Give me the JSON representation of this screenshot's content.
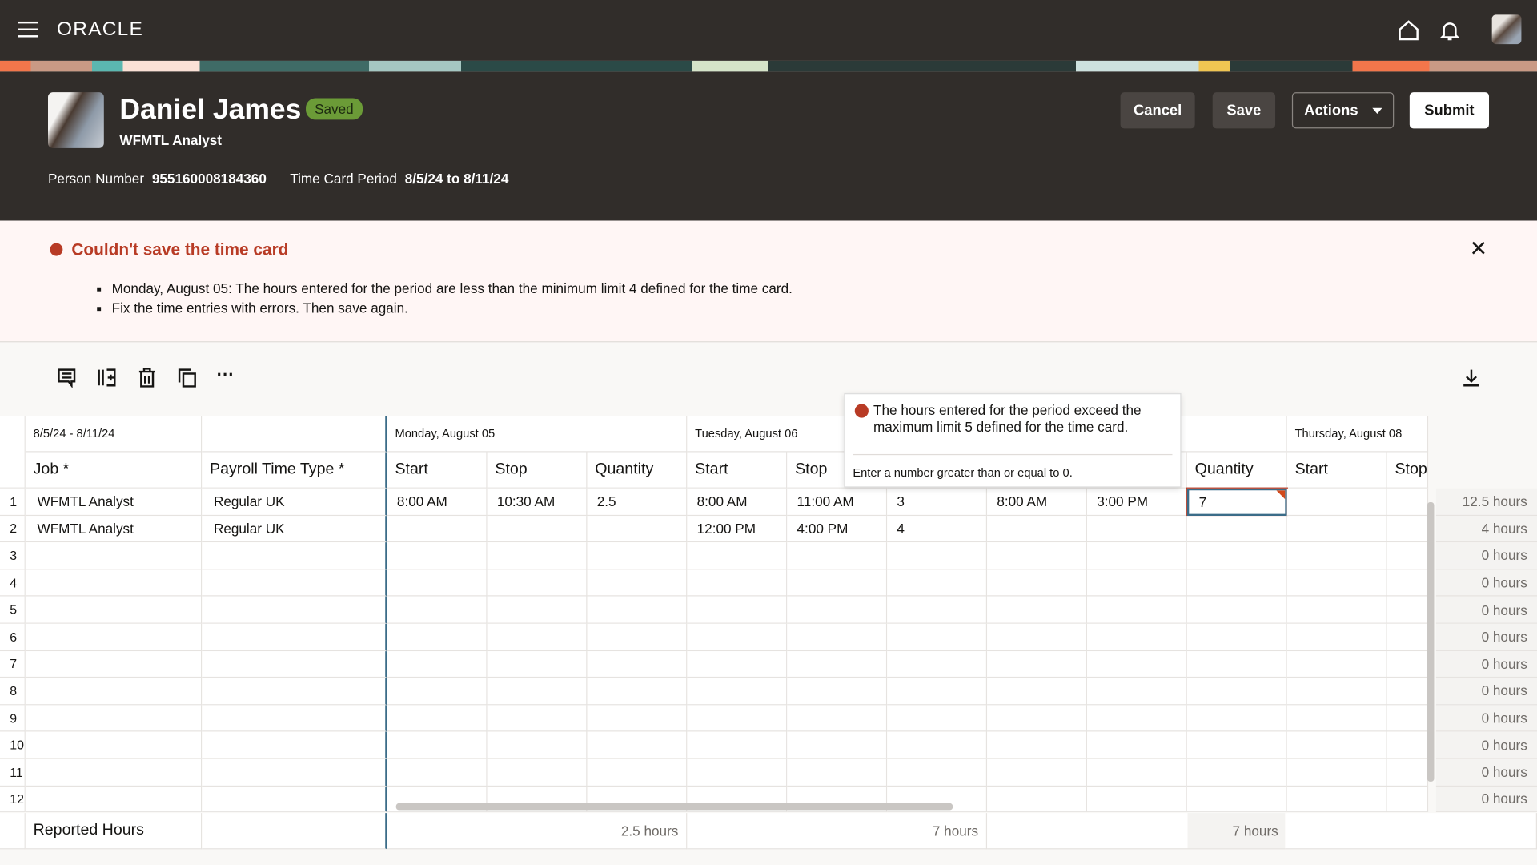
{
  "app": {
    "brand": "ORACLE"
  },
  "person": {
    "name": "Daniel James",
    "status": "Saved",
    "title": "WFMTL Analyst",
    "person_number_label": "Person Number",
    "person_number": "955160008184360",
    "period_label": "Time Card Period",
    "period": "8/5/24 to 8/11/24"
  },
  "actions": {
    "cancel": "Cancel",
    "save": "Save",
    "actions": "Actions",
    "submit": "Submit"
  },
  "error": {
    "title": "Couldn't save the time card",
    "items": [
      "Monday, August 05: The hours entered for the period are less than the minimum limit 4 defined for the time card.",
      "Fix the time entries with errors. Then save again."
    ],
    "color": "#b83b25"
  },
  "tooltip": {
    "message": "The hours entered for the period exceed the maximum limit 5 defined for the time card.",
    "hint": "Enter a number greater than or equal to 0."
  },
  "grid": {
    "period": "8/5/24 - 8/11/24",
    "days": [
      "Monday, August 05",
      "Tuesday, August 06",
      "",
      "Thursday, August 08"
    ],
    "col_job": "Job *",
    "col_ptt": "Payroll Time Type *",
    "sub": [
      "Start",
      "Stop",
      "Quantity"
    ],
    "rows": [
      {
        "n": "1",
        "job": "WFMTL Analyst",
        "ptt": "Regular UK",
        "vals": [
          "8:00 AM",
          "10:30 AM",
          "2.5",
          "8:00 AM",
          "11:00 AM",
          "3",
          "8:00 AM",
          "3:00 PM",
          "7",
          "",
          ""
        ],
        "total": "12.5 hours"
      },
      {
        "n": "2",
        "job": "WFMTL Analyst",
        "ptt": "Regular UK",
        "vals": [
          "",
          "",
          "",
          "12:00 PM",
          "4:00 PM",
          "4",
          "",
          "",
          "",
          "",
          ""
        ],
        "total": "4 hours"
      },
      {
        "n": "3",
        "job": "",
        "ptt": "",
        "vals": [],
        "total": "0 hours"
      },
      {
        "n": "4",
        "job": "",
        "ptt": "",
        "vals": [],
        "total": "0 hours"
      },
      {
        "n": "5",
        "job": "",
        "ptt": "",
        "vals": [],
        "total": "0 hours"
      },
      {
        "n": "6",
        "job": "",
        "ptt": "",
        "vals": [],
        "total": "0 hours"
      },
      {
        "n": "7",
        "job": "",
        "ptt": "",
        "vals": [],
        "total": "0 hours"
      },
      {
        "n": "8",
        "job": "",
        "ptt": "",
        "vals": [],
        "total": "0 hours"
      },
      {
        "n": "9",
        "job": "",
        "ptt": "",
        "vals": [],
        "total": "0 hours"
      },
      {
        "n": "10",
        "job": "",
        "ptt": "",
        "vals": [],
        "total": "0 hours"
      },
      {
        "n": "11",
        "job": "",
        "ptt": "",
        "vals": [],
        "total": "0 hours"
      },
      {
        "n": "12",
        "job": "",
        "ptt": "",
        "vals": [],
        "total": "0 hours"
      }
    ],
    "reported_label": "Reported Hours",
    "reported": [
      "2.5 hours",
      "7 hours",
      "7 hours"
    ]
  }
}
